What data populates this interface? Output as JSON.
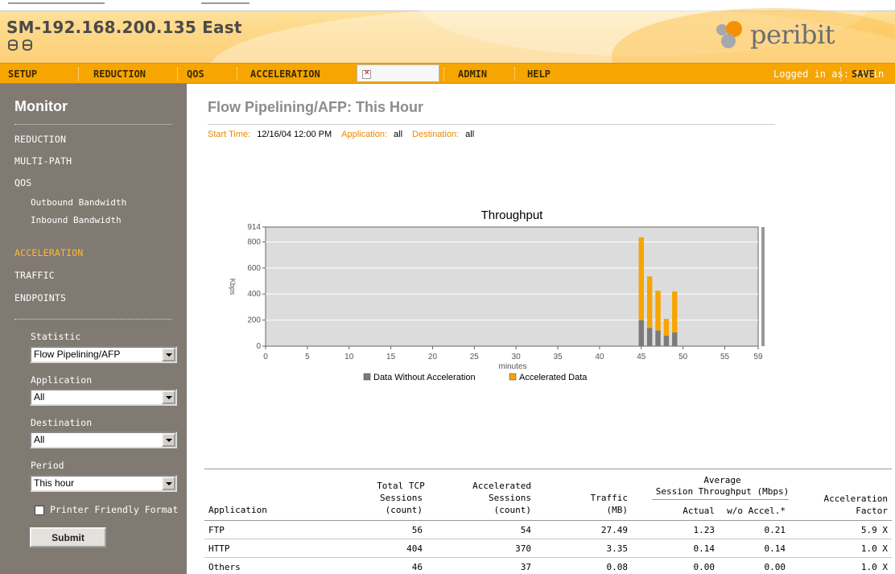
{
  "header": {
    "device_title": "SM-192.168.200.135 East",
    "logo_text": "peribit"
  },
  "nav": {
    "items": [
      "SETUP",
      "REDUCTION",
      "QOS",
      "ACCELERATION",
      "ADMIN",
      "HELP"
    ],
    "logged_in": "Logged in as: admin",
    "save": "SAVE"
  },
  "sidebar": {
    "title": "Monitor",
    "links": [
      "REDUCTION",
      "MULTI-PATH",
      "QOS"
    ],
    "qos_sub": [
      "Outbound Bandwidth",
      "Inbound Bandwidth"
    ],
    "links2": [
      "ACCELERATION",
      "TRAFFIC",
      "ENDPOINTS"
    ],
    "statistic_label": "Statistic",
    "statistic_value": "Flow Pipelining/AFP",
    "application_label": "Application",
    "application_value": "All",
    "destination_label": "Destination",
    "destination_value": "All",
    "period_label": "Period",
    "period_value": "This hour",
    "printer_label": "Printer Friendly Format",
    "submit": "Submit"
  },
  "main": {
    "title": "Flow Pipelining/AFP: This Hour",
    "start_time_label": "Start Time:",
    "start_time": "12/16/04 12:00 PM",
    "application_label": "Application:",
    "application": "all",
    "destination_label": "Destination:",
    "destination": "all"
  },
  "chart_data": {
    "type": "bar",
    "stacked": true,
    "title": "Throughput",
    "xlabel": "minutes",
    "ylabel": "Kbps",
    "xlim": [
      0,
      59
    ],
    "ylim": [
      0,
      914
    ],
    "x_ticks": [
      "0",
      "5",
      "10",
      "15",
      "20",
      "25",
      "30",
      "35",
      "40",
      "45",
      "50",
      "55",
      "59"
    ],
    "y_ticks": [
      "0",
      "200",
      "400",
      "600",
      "800",
      "914"
    ],
    "grid": true,
    "legend_position": "bottom",
    "colors": {
      "Data Without Acceleration": "#7a7a7a",
      "Accelerated Data": "#f7a500",
      "plot_bg": "#dcdcdc"
    },
    "x": [
      45,
      46,
      47,
      48,
      49
    ],
    "series": [
      {
        "name": "Data Without Acceleration",
        "values": [
          200,
          140,
          120,
          80,
          105
        ]
      },
      {
        "name": "Accelerated Data",
        "values": [
          635,
          395,
          305,
          130,
          315
        ]
      }
    ]
  },
  "table": {
    "headers": {
      "application": "Application",
      "total_tcp": [
        "Total TCP",
        "Sessions",
        "(count)"
      ],
      "accelerated": [
        "Accelerated",
        "Sessions",
        "(count)"
      ],
      "traffic": [
        "Traffic",
        "(MB)"
      ],
      "avg_group": [
        "Average",
        "Session Throughput (Mbps)"
      ],
      "actual": "Actual",
      "wo_accel": "w/o Accel.*",
      "factor": [
        "Acceleration",
        "Factor"
      ]
    },
    "rows": [
      {
        "app": "FTP",
        "total": "56",
        "accel": "54",
        "traffic": "27.49",
        "actual": "1.23",
        "wo": "0.21",
        "factor": "5.9 X"
      },
      {
        "app": "HTTP",
        "total": "404",
        "accel": "370",
        "traffic": "3.35",
        "actual": "0.14",
        "wo": "0.14",
        "factor": "1.0 X"
      },
      {
        "app": "Others",
        "total": "46",
        "accel": "37",
        "traffic": "0.08",
        "actual": "0.00",
        "wo": "0.00",
        "factor": "1.0 X"
      }
    ]
  }
}
